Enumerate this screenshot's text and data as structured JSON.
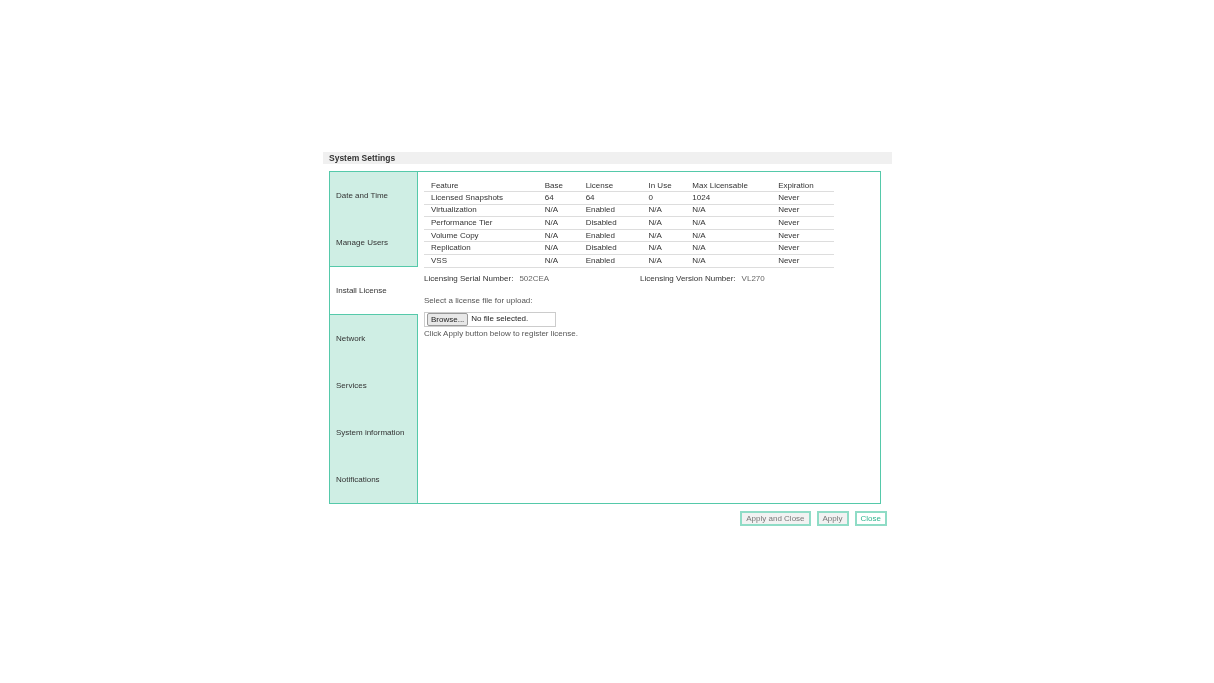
{
  "title": "System Settings",
  "sidebar": {
    "items": [
      {
        "label": "Date and Time",
        "selected": false
      },
      {
        "label": "Manage Users",
        "selected": false
      },
      {
        "label": "Install License",
        "selected": true
      },
      {
        "label": "Network",
        "selected": false
      },
      {
        "label": "Services",
        "selected": false
      },
      {
        "label": "System information",
        "selected": false
      },
      {
        "label": "Notifications",
        "selected": false
      }
    ]
  },
  "table": {
    "columns": [
      "Feature",
      "Base",
      "License",
      "In Use",
      "Max Licensable",
      "Expiration"
    ],
    "rows": [
      [
        "Licensed Snapshots",
        "64",
        "64",
        "0",
        "1024",
        "Never"
      ],
      [
        "Virtualization",
        "N/A",
        "Enabled",
        "N/A",
        "N/A",
        "Never"
      ],
      [
        "Performance Tier",
        "N/A",
        "Disabled",
        "N/A",
        "N/A",
        "Never"
      ],
      [
        "Volume Copy",
        "N/A",
        "Enabled",
        "N/A",
        "N/A",
        "Never"
      ],
      [
        "Replication",
        "N/A",
        "Disabled",
        "N/A",
        "N/A",
        "Never"
      ],
      [
        "VSS",
        "N/A",
        "Enabled",
        "N/A",
        "N/A",
        "Never"
      ]
    ]
  },
  "serial": {
    "label": "Licensing Serial Number:",
    "value": "502CEA"
  },
  "version": {
    "label": "Licensing Version Number:",
    "value": "VL270"
  },
  "upload_label": "Select a license file for upload:",
  "file": {
    "button": "Browse...",
    "status": "No file selected."
  },
  "hint": "Click Apply button below to register license.",
  "buttons": [
    {
      "label": "Apply and Close",
      "disabled": true
    },
    {
      "label": "Apply",
      "disabled": true
    },
    {
      "label": "Close",
      "disabled": false
    }
  ]
}
